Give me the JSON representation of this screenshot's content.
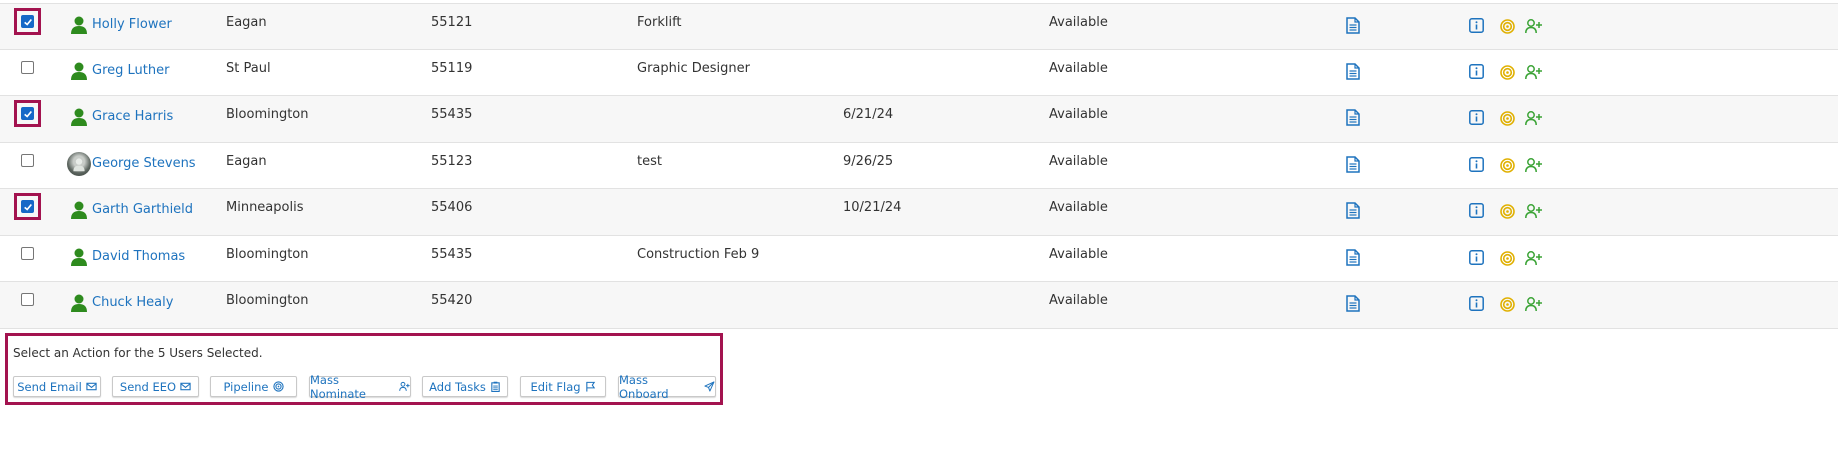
{
  "rows": [
    {
      "name": "Holly Flower",
      "city": "Eagan",
      "zip": "55121",
      "tag": "Forklift",
      "date": "",
      "status": "Available",
      "checked": true
    },
    {
      "name": "Greg Luther",
      "city": "St Paul",
      "zip": "55119",
      "tag": "Graphic Designer",
      "date": "",
      "status": "Available",
      "checked": false
    },
    {
      "name": "Grace Harris",
      "city": "Bloomington",
      "zip": "55435",
      "tag": "",
      "date": "6/21/24",
      "status": "Available",
      "checked": true
    },
    {
      "name": "George Stevens",
      "city": "Eagan",
      "zip": "55123",
      "tag": "test",
      "date": "9/26/25",
      "status": "Available",
      "checked": false
    },
    {
      "name": "Garth Garthield",
      "city": "Minneapolis",
      "zip": "55406",
      "tag": "",
      "date": "10/21/24",
      "status": "Available",
      "checked": true
    },
    {
      "name": "David Thomas",
      "city": "Bloomington",
      "zip": "55435",
      "tag": "Construction Feb 9",
      "date": "",
      "status": "Available",
      "checked": false
    },
    {
      "name": "Chuck Healy",
      "city": "Bloomington",
      "zip": "55420",
      "tag": "",
      "date": "",
      "status": "Available",
      "checked": false
    }
  ],
  "actions": {
    "title": "Select an Action for the 5 Users Selected.",
    "send_email": "Send Email",
    "send_eeo": "Send EEO",
    "pipeline": "Pipeline",
    "mass_nominate": "Mass Nominate",
    "add_tasks": "Add Tasks",
    "edit_flag": "Edit Flag",
    "mass_onboard": "Mass Onboard"
  },
  "colors": {
    "link": "#1e73be",
    "highlight": "#a3134f",
    "avatar_green": "#2e8b1e",
    "target_yellow": "#e0b000",
    "adduser_green": "#3aa335"
  },
  "icons": {
    "avatar": "person-silhouette-icon",
    "doc": "document-icon",
    "info": "info-icon",
    "target": "target-icon",
    "adduser": "add-user-icon"
  }
}
